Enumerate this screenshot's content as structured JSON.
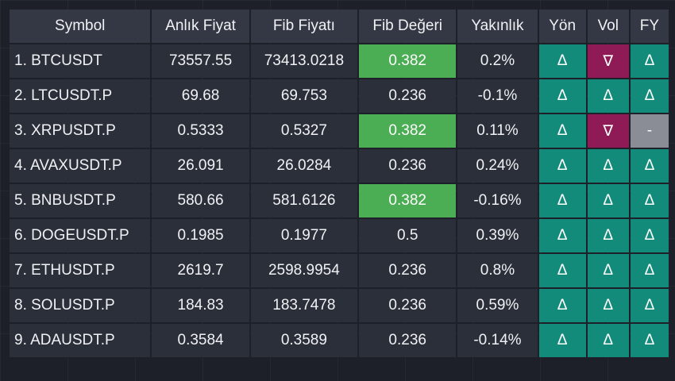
{
  "colors": {
    "background": "#1d2029",
    "header_bg": "#343844",
    "cell_bg": "#2b2f3a",
    "fib_highlight": "#4cae54",
    "up": "#138b7a",
    "down": "#8e1b55",
    "neutral": "#8a8d96",
    "text": "#f0f1f4"
  },
  "glyphs": {
    "up": "Δ",
    "down": "∇",
    "neutral": "-"
  },
  "table": {
    "headers": [
      "Symbol",
      "Anlık Fiyat",
      "Fib Fiyatı",
      "Fib Değeri",
      "Yakınlık",
      "Yön",
      "Vol",
      "FY"
    ],
    "rows": [
      {
        "symbol": "1. BTCUSDT",
        "price": "73557.55",
        "fib_price": "73413.0218",
        "fib_value": "0.382",
        "fib_highlight": true,
        "nearness": "0.2%",
        "dir": "up",
        "vol": "down",
        "fy": "up"
      },
      {
        "symbol": "2. LTCUSDT.P",
        "price": "69.68",
        "fib_price": "69.753",
        "fib_value": "0.236",
        "fib_highlight": false,
        "nearness": "-0.1%",
        "dir": "up",
        "vol": "up",
        "fy": "up"
      },
      {
        "symbol": "3. XRPUSDT.P",
        "price": "0.5333",
        "fib_price": "0.5327",
        "fib_value": "0.382",
        "fib_highlight": true,
        "nearness": "0.11%",
        "dir": "up",
        "vol": "down",
        "fy": "neutral"
      },
      {
        "symbol": "4. AVAXUSDT.P",
        "price": "26.091",
        "fib_price": "26.0284",
        "fib_value": "0.236",
        "fib_highlight": false,
        "nearness": "0.24%",
        "dir": "up",
        "vol": "up",
        "fy": "up"
      },
      {
        "symbol": "5. BNBUSDT.P",
        "price": "580.66",
        "fib_price": "581.6126",
        "fib_value": "0.382",
        "fib_highlight": true,
        "nearness": "-0.16%",
        "dir": "up",
        "vol": "up",
        "fy": "up"
      },
      {
        "symbol": "6. DOGEUSDT.P",
        "price": "0.1985",
        "fib_price": "0.1977",
        "fib_value": "0.5",
        "fib_highlight": false,
        "nearness": "0.39%",
        "dir": "up",
        "vol": "up",
        "fy": "up"
      },
      {
        "symbol": "7. ETHUSDT.P",
        "price": "2619.7",
        "fib_price": "2598.9954",
        "fib_value": "0.236",
        "fib_highlight": false,
        "nearness": "0.8%",
        "dir": "up",
        "vol": "up",
        "fy": "up"
      },
      {
        "symbol": "8. SOLUSDT.P",
        "price": "184.83",
        "fib_price": "183.7478",
        "fib_value": "0.236",
        "fib_highlight": false,
        "nearness": "0.59%",
        "dir": "up",
        "vol": "up",
        "fy": "up"
      },
      {
        "symbol": "9. ADAUSDT.P",
        "price": "0.3584",
        "fib_price": "0.3589",
        "fib_value": "0.236",
        "fib_highlight": false,
        "nearness": "-0.14%",
        "dir": "up",
        "vol": "up",
        "fy": "up"
      }
    ]
  }
}
